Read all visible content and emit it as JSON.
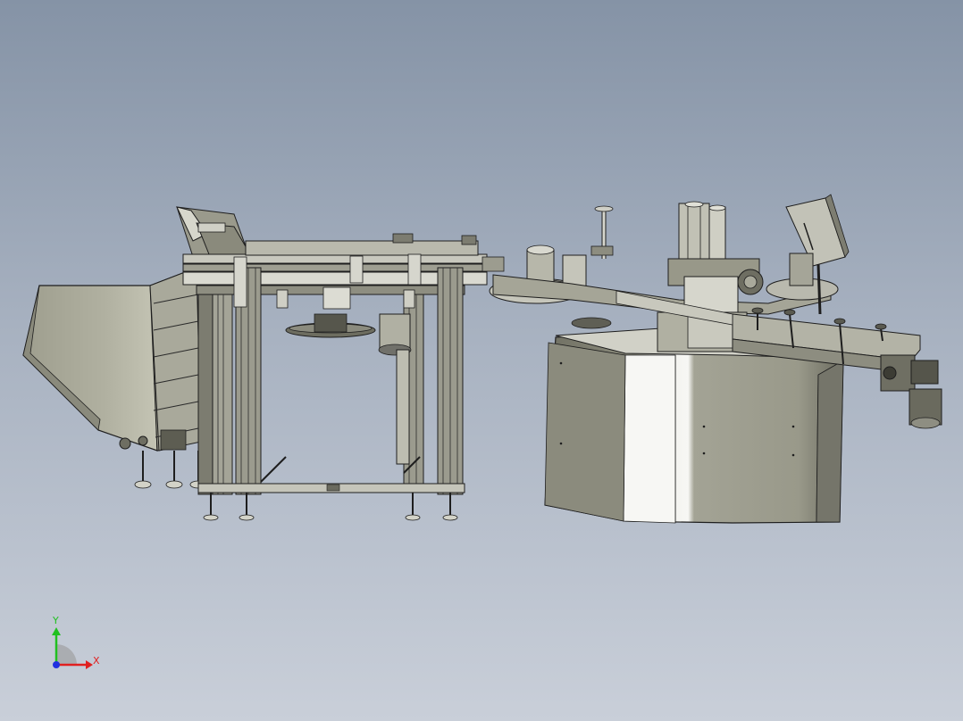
{
  "viewport": {
    "background_top": "#8593a6",
    "background_bottom": "#c9cfd9"
  },
  "triad": {
    "x_label": "X",
    "y_label": "Y",
    "x_color": "#e02020",
    "y_color": "#20c020",
    "z_color": "#2030e0"
  },
  "model": {
    "part_fill": "#b5b5a8",
    "part_shadow": "#7e7e70",
    "part_dark": "#4b4b44",
    "part_light": "#e9e9e1",
    "outline": "#1e1e1e"
  }
}
